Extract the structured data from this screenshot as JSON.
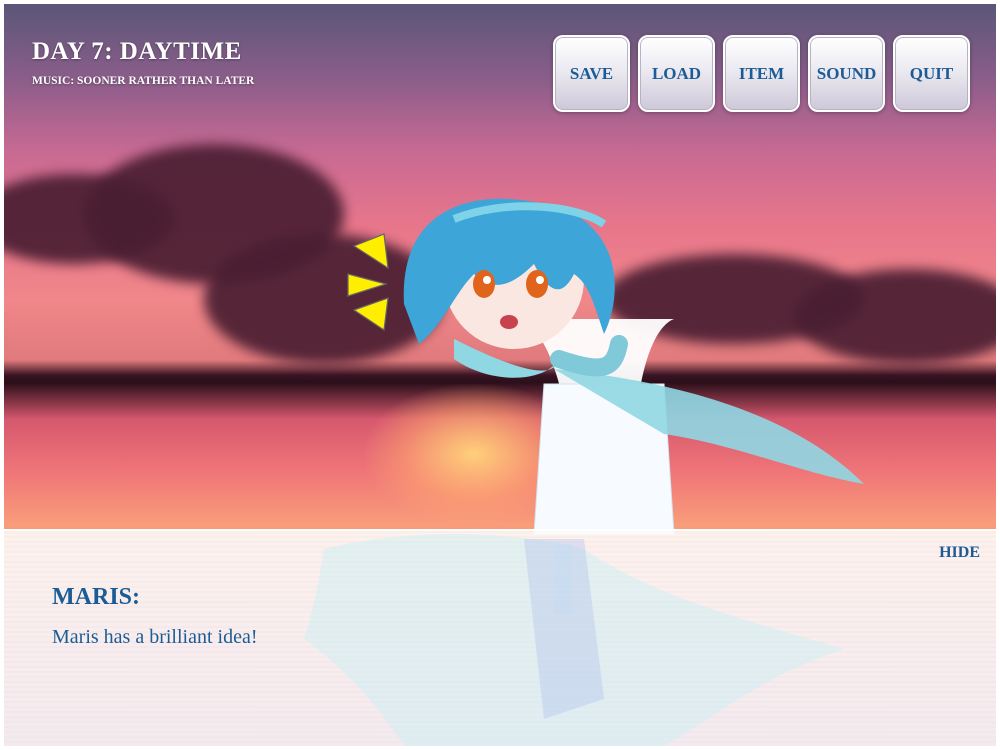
{
  "header": {
    "title": "DAY 7: DAYTIME",
    "music": "MUSIC: SOONER RATHER THAN LATER"
  },
  "menu": [
    {
      "id": "save",
      "label": "SAVE"
    },
    {
      "id": "load",
      "label": "LOAD"
    },
    {
      "id": "item",
      "label": "ITEM"
    },
    {
      "id": "sound",
      "label": "SOUND"
    },
    {
      "id": "quit",
      "label": "QUIT"
    }
  ],
  "dialog": {
    "hide_label": "HIDE",
    "speaker": "MARIS:",
    "text": "Maris has a brilliant idea!"
  },
  "colors": {
    "ui_text": "#1c5c96",
    "alert_marks": "#ffee00"
  }
}
